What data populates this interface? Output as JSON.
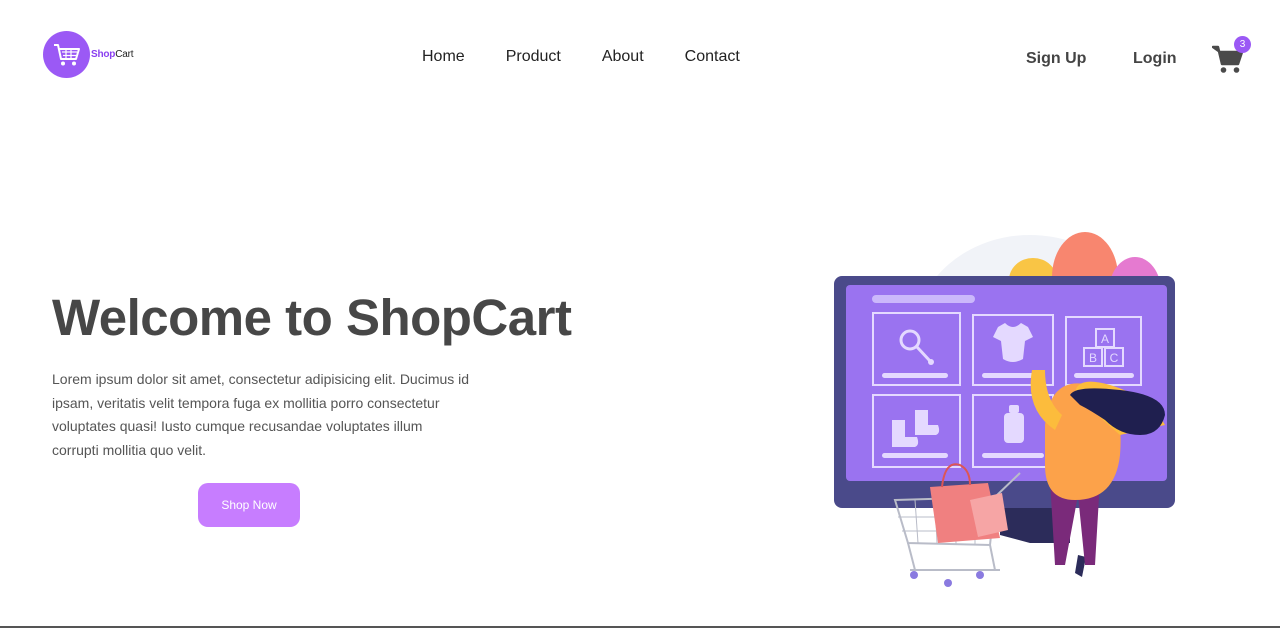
{
  "brand": {
    "shop": "Shop",
    "cart": "Cart"
  },
  "nav": {
    "items": [
      "Home",
      "Product",
      "About",
      "Contact"
    ]
  },
  "auth": {
    "signup": "Sign Up",
    "login": "Login"
  },
  "cart": {
    "count": "3"
  },
  "hero": {
    "title": "Welcome to ShopCart",
    "text": "Lorem ipsum dolor sit amet, consectetur adipisicing elit. Ducimus id ipsam, veritatis velit tempora fuga ex mollitia porro consectetur voluptates quasi! Iusto cumque recusandae voluptates illum corrupti mollitia quo velit.",
    "button": "Shop Now"
  },
  "colors": {
    "accent": "#9b59f5",
    "button": "#c77dff",
    "text": "#474747"
  },
  "illustration": {
    "letters": [
      "A",
      "B",
      "C"
    ]
  }
}
